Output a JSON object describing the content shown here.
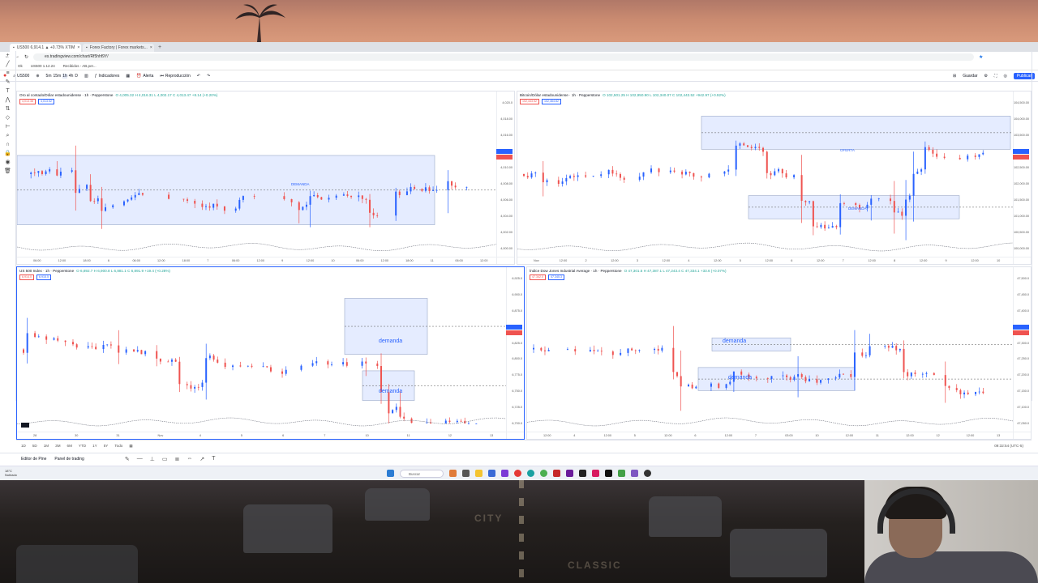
{
  "browser": {
    "tabs": [
      {
        "label": "US500 6,914.1 ▲ +0.73% XTIM"
      },
      {
        "label": "Forex Factory | Forex markets..."
      }
    ],
    "url": "es.tradingview.com/chart/Rf5hhf9Y/",
    "bookmarks": [
      "Ok",
      "US500 1.12.24",
      "Recibidos - AB.per..."
    ]
  },
  "toolbar": {
    "symbol": "US500",
    "intervals": [
      "5m",
      "15m",
      "1h",
      "4h",
      "D"
    ],
    "indicators": "Indicadores",
    "alert": "Alerta",
    "replay": "Reproducción",
    "save": "Guardar",
    "publish": "Publicar"
  },
  "panels": [
    {
      "title": "Oro al contado/Dólar estadounidense · 1h · Pepperstone",
      "ohlc": "O 4,005.32 H 4,016.31 L 4,002.17 C 4,013.47 +8.14 (+0.20%)",
      "sell": "4,013.38",
      "buy": "4,013.52",
      "zones": [
        "DEMANDA"
      ],
      "prices": [
        "4,020.0",
        "4,018.00",
        "4,016.00",
        "4,013.00",
        "4,010.00",
        "4,008.00",
        "4,006.00",
        "4,004.00",
        "4,002.00",
        "4,000.00"
      ],
      "times": [
        "06:00",
        "12:00",
        "18:00",
        "6",
        "06:00",
        "12:00",
        "18:00",
        "7",
        "06:00",
        "12:00",
        "9",
        "12:00",
        "10",
        "06:00",
        "12:00",
        "18:00",
        "11",
        "06:00",
        "12:00"
      ]
    },
    {
      "title": "Bitcoin/Dólar estadounidense · 1h · Pepperstone",
      "ohlc": "O 102,501.25 H 102,950.90 L 102,340.07 C 102,443.52 +942.97 (+0.92%)",
      "sell": "102,443.52",
      "buy": "102,464.82",
      "zones": [
        "OFERTA",
        "DEMANDA"
      ],
      "prices": [
        "104,500.00",
        "104,000.00",
        "103,500.00",
        "103,000.00",
        "102,500.00",
        "102,000.00",
        "101,500.00",
        "101,000.00",
        "100,500.00",
        "100,000.00"
      ],
      "times": [
        "Nov",
        "12:00",
        "2",
        "12:00",
        "3",
        "12:00",
        "4",
        "12:00",
        "5",
        "12:00",
        "6",
        "12:00",
        "7",
        "12:00",
        "8",
        "12:00",
        "9",
        "12:00",
        "10"
      ]
    },
    {
      "title": "US 500 Index · 1h · Pepperstone",
      "ohlc": "O 6,892.7 H 6,900.8 L 6,881.1 C 6,891.9 +19.4 (+0.28%)",
      "sell": "6,914.0",
      "buy": "6,915.5",
      "zones": [
        "demanda",
        "demanda"
      ],
      "prices": [
        "6,925.0",
        "6,900.0",
        "6,875.0",
        "6,850.0",
        "6,825.0",
        "6,800.0",
        "6,775.0",
        "6,750.0",
        "6,725.0",
        "6,700.0"
      ],
      "times": [
        "28",
        "30",
        "31",
        "Nov",
        "4",
        "5",
        "6",
        "7",
        "10",
        "11",
        "12",
        "13"
      ]
    },
    {
      "title": "Índice Dow Jones Industrial Average · 1h · Pepperstone",
      "ohlc": "O 47,301.5 H 47,387.1 L 47,243.4 C 47,334.1 +33.6 (+0.07%)",
      "sell": "47,342.0",
      "buy": "47,345.3",
      "zones": [
        "demanda",
        "demanda"
      ],
      "prices": [
        "47,500.0",
        "47,450.0",
        "47,400.0",
        "47,350.0",
        "47,300.0",
        "47,250.0",
        "47,200.0",
        "47,150.0",
        "47,100.0",
        "47,050.0"
      ],
      "times": [
        "12:00",
        "4",
        "12:00",
        "5",
        "12:00",
        "6",
        "12:00",
        "7",
        "03:00",
        "10",
        "12:00",
        "11",
        "12:00",
        "12",
        "12:00",
        "13"
      ]
    }
  ],
  "bottom": {
    "ranges": [
      "1D",
      "5D",
      "1M",
      "3M",
      "6M",
      "YTD",
      "1Y",
      "5Y",
      "Todo"
    ],
    "clock": "09:32:54 (UTC-5)"
  },
  "trading_panel": {
    "editor": "Editor de Pine",
    "panel": "Panel de trading"
  },
  "taskbar": {
    "weather_temp": "18°C",
    "weather_desc": "Nublado",
    "search": "Buscar"
  }
}
